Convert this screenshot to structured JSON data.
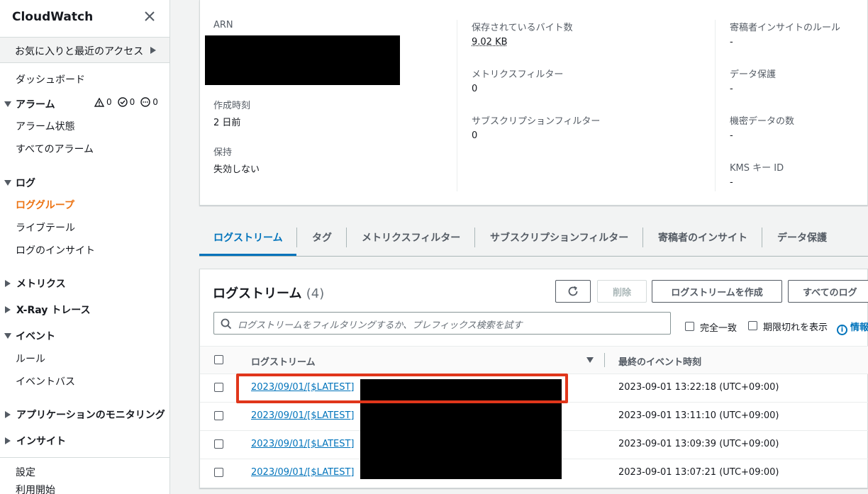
{
  "sidebar": {
    "title": "CloudWatch",
    "favorites": "お気に入りと最近のアクセス",
    "dashboard": "ダッシュボード",
    "alarm_section": "アラーム",
    "alarm_counts": {
      "warning": "0",
      "ok": "0",
      "insufficient": "0"
    },
    "alarm_items": [
      "アラーム状態",
      "すべてのアラーム"
    ],
    "logs_section": "ログ",
    "logs_items": [
      "ロググループ",
      "ライブテール",
      "ログのインサイト"
    ],
    "metrics": "メトリクス",
    "xray": "X-Ray トレース",
    "events_section": "イベント",
    "events_items": [
      "ルール",
      "イベントバス"
    ],
    "appmon": "アプリケーションのモニタリング",
    "insights": "インサイト",
    "settings": "設定",
    "getting_started": "利用開始",
    "active_color": "#ec7211"
  },
  "details": {
    "arn_label": "ARN",
    "created_label": "作成時刻",
    "created_value": "2 日前",
    "retention_label": "保持",
    "retention_value": "失効しない",
    "stored_bytes_label": "保存されているバイト数",
    "stored_bytes_value": "9.02 KB",
    "metric_filters_label": "メトリクスフィルター",
    "metric_filters_value": "0",
    "subscription_filters_label": "サブスクリプションフィルター",
    "subscription_filters_value": "0",
    "contributor_label": "寄稿者インサイトのルール",
    "contributor_value": "-",
    "data_protection_label": "データ保護",
    "data_protection_value": "-",
    "sensitive_label": "機密データの数",
    "sensitive_value": "-",
    "kms_label": "KMS キー ID",
    "kms_value": "-"
  },
  "tabs": [
    "ログストリーム",
    "タグ",
    "メトリクスフィルター",
    "サブスクリプションフィルター",
    "寄稿者のインサイト",
    "データ保護"
  ],
  "streams": {
    "title": "ログストリーム",
    "count": "(4)",
    "delete_label": "削除",
    "create_label": "ログストリームを作成",
    "search_all_label": "すべてのログ",
    "search_placeholder": "ログストリームをフィルタリングするか、プレフィックス検索を試す",
    "exact_match_label": "完全一致",
    "show_expired_label": "期限切れを表示",
    "info_label": "情報",
    "col_stream": "ログストリーム",
    "col_last_event": "最終のイベント時刻",
    "rows": [
      {
        "name": "2023/09/01/[$LATEST]",
        "time": "2023-09-01 13:22:18 (UTC+09:00)"
      },
      {
        "name": "2023/09/01/[$LATEST]",
        "time": "2023-09-01 13:11:10 (UTC+09:00)"
      },
      {
        "name": "2023/09/01/[$LATEST]",
        "time": "2023-09-01 13:09:39 (UTC+09:00)"
      },
      {
        "name": "2023/09/01/[$LATEST]",
        "time": "2023-09-01 13:07:21 (UTC+09:00)"
      }
    ]
  },
  "colors": {
    "link": "#0073bb",
    "highlight": "#e0361b",
    "accent": "#ec7211"
  }
}
